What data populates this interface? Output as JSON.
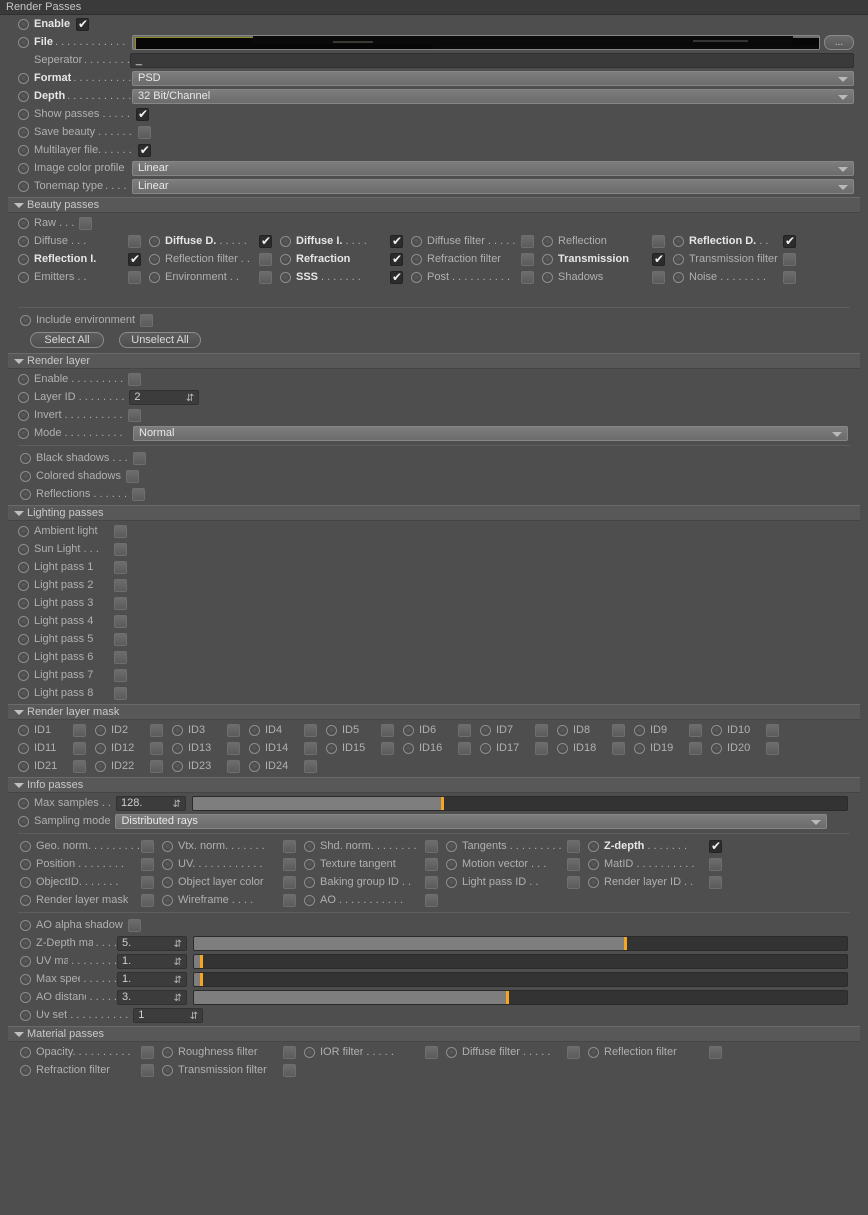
{
  "window": {
    "title": "Render Passes"
  },
  "top": {
    "enable": {
      "label": "Enable",
      "checked": true
    },
    "file": {
      "label": "File",
      "dots": ". . . . . . . . . . . .",
      "value": "",
      "browse_label": "..."
    },
    "seperator": {
      "label": "Seperator",
      "dots": ". . . . . . . .",
      "value": "_"
    },
    "format": {
      "label": "Format",
      "dots": ". . . . . . . . . .",
      "value": "PSD"
    },
    "depth": {
      "label": "Depth",
      "dots": ". . . . . . . . . . .",
      "value": "32 Bit/Channel"
    },
    "show_passes": {
      "label": "Show passes",
      "dots": ". . . . .",
      "checked": true
    },
    "save_beauty": {
      "label": "Save beauty",
      "dots": ". . . . . .",
      "checked": false
    },
    "multilayer_file": {
      "label": "Multilayer file.",
      "dots": ". . . . .",
      "checked": true
    },
    "image_color_profile": {
      "label": "Image color profile",
      "value": "Linear"
    },
    "tonemap_type": {
      "label": "Tonemap type",
      "dots": ". . . .",
      "value": "Linear"
    }
  },
  "beauty_passes": {
    "title": "Beauty passes",
    "raw": {
      "label": "Raw",
      "dots": ". . .",
      "checked": false,
      "bold": false
    },
    "rows": [
      [
        {
          "label": "Diffuse",
          "dots": ". . .",
          "checked": false,
          "bold": false
        },
        {
          "label": "Diffuse D.",
          "dots": ". . . . .",
          "checked": true,
          "bold": true
        },
        {
          "label": "Diffuse I.",
          "dots": ". . . .",
          "checked": true,
          "bold": true
        },
        {
          "label": "Diffuse filter",
          "dots": ". . . . .",
          "checked": false,
          "bold": false
        }
      ],
      [
        {
          "label": "Reflection",
          "dots": "",
          "checked": false,
          "bold": false
        },
        {
          "label": "Reflection D.",
          "dots": ". .",
          "checked": true,
          "bold": true
        },
        {
          "label": "Reflection I.",
          "dots": "",
          "checked": true,
          "bold": true
        },
        {
          "label": "Reflection filter",
          "dots": ". .",
          "checked": false,
          "bold": false
        }
      ],
      [
        {
          "label": "Refraction",
          "dots": "",
          "checked": true,
          "bold": true
        },
        {
          "label": "Refraction filter",
          "dots": "",
          "checked": false,
          "bold": false
        },
        {
          "label": "Transmission",
          "dots": "",
          "checked": true,
          "bold": true
        },
        {
          "label": "Transmission filter",
          "dots": "",
          "checked": false,
          "bold": false
        }
      ],
      [
        {
          "label": "Emitters",
          "dots": ". .",
          "checked": false,
          "bold": false
        },
        {
          "label": "Environment",
          "dots": ". .",
          "checked": false,
          "bold": false
        },
        {
          "label": "SSS",
          "dots": ". . . . . . .",
          "checked": true,
          "bold": true
        },
        {
          "label": "Post",
          "dots": ". . . . . . . . . .",
          "checked": false,
          "bold": false
        }
      ],
      [
        {
          "label": "Shadows",
          "dots": "",
          "checked": false,
          "bold": false
        },
        {
          "label": "Noise",
          "dots": ". . . . . . . .",
          "checked": false,
          "bold": false
        }
      ]
    ],
    "include_environment": {
      "label": "Include environment",
      "checked": false
    },
    "select_all_label": "Select All",
    "unselect_all_label": "Unselect All"
  },
  "render_layer": {
    "title": "Render layer",
    "enable": {
      "label": "Enable",
      "dots": ". . . . . . . . .",
      "checked": false
    },
    "layer_id": {
      "label": "Layer ID",
      "dots": ". . . . . . . .",
      "value": "2"
    },
    "invert": {
      "label": "Invert",
      "dots": ". . . . . . . . . .",
      "checked": false
    },
    "mode": {
      "label": "Mode",
      "dots": ". . . . . . . . . .",
      "value": "Normal"
    },
    "black_shadows": {
      "label": "Black shadows",
      "dots": ". . .",
      "checked": false
    },
    "colored_shadows": {
      "label": "Colored shadows",
      "dots": "",
      "checked": false
    },
    "reflections": {
      "label": "Reflections",
      "dots": ". . . . . .",
      "checked": false
    }
  },
  "lighting_passes": {
    "title": "Lighting passes",
    "items": [
      {
        "label": "Ambient light",
        "dots": "",
        "checked": false
      },
      {
        "label": "Sun Light",
        "dots": ". . .",
        "checked": false
      },
      {
        "label": "Light pass 1",
        "dots": "",
        "checked": false
      },
      {
        "label": "Light pass 2",
        "dots": "",
        "checked": false
      },
      {
        "label": "Light pass 3",
        "dots": "",
        "checked": false
      },
      {
        "label": "Light pass 4",
        "dots": "",
        "checked": false
      },
      {
        "label": "Light pass 5",
        "dots": "",
        "checked": false
      },
      {
        "label": "Light pass 6",
        "dots": "",
        "checked": false
      },
      {
        "label": "Light pass 7",
        "dots": "",
        "checked": false
      },
      {
        "label": "Light pass 8",
        "dots": "",
        "checked": false
      }
    ]
  },
  "render_layer_mask": {
    "title": "Render layer mask",
    "ids": [
      "ID1",
      "ID2",
      "ID3",
      "ID4",
      "ID5",
      "ID6",
      "ID7",
      "ID8",
      "ID9",
      "ID10",
      "ID11",
      "ID12",
      "ID13",
      "ID14",
      "ID15",
      "ID16",
      "ID17",
      "ID18",
      "ID19",
      "ID20",
      "ID21",
      "ID22",
      "ID23",
      "ID24"
    ]
  },
  "info_passes": {
    "title": "Info passes",
    "max_samples": {
      "label": "Max samples",
      "dots": ". .",
      "value": "128.",
      "fill_pct": 38,
      "mark_pct": 38
    },
    "sampling_mode": {
      "label": "Sampling mode",
      "value": "Distributed rays"
    },
    "rows": [
      [
        {
          "label": "Geo. norm.",
          "dots": ". . . . . . . .",
          "checked": false,
          "bold": false
        },
        {
          "label": "Vtx. norm.",
          "dots": ". . . . . .",
          "checked": false,
          "bold": false
        },
        {
          "label": "Shd. norm.",
          "dots": ". . . . . . .",
          "checked": false,
          "bold": false
        }
      ],
      [
        {
          "label": "Tangents",
          "dots": ". . . . . . . . .",
          "checked": false,
          "bold": false
        },
        {
          "label": "Z-depth",
          "dots": ". . . . . . .",
          "checked": true,
          "bold": true
        },
        {
          "label": "Position",
          "dots": ". . . . . . . .",
          "checked": false,
          "bold": false
        }
      ],
      [
        {
          "label": "UV.",
          "dots": ". . . . . . . . . . .",
          "checked": false,
          "bold": false
        },
        {
          "label": "Texture tangent",
          "dots": "",
          "checked": false,
          "bold": false
        },
        {
          "label": "Motion vector",
          "dots": ". . .",
          "checked": false,
          "bold": false
        }
      ],
      [
        {
          "label": "MatID",
          "dots": ". . . . . . . . . .",
          "checked": false,
          "bold": false
        },
        {
          "label": "ObjectID.",
          "dots": ". . . . . .",
          "checked": false,
          "bold": false
        },
        {
          "label": "Object layer color",
          "dots": "",
          "checked": false,
          "bold": false
        }
      ],
      [
        {
          "label": "Baking group ID",
          "dots": ". .",
          "checked": false,
          "bold": false
        },
        {
          "label": "Light pass ID",
          "dots": ". .",
          "checked": false,
          "bold": false
        },
        {
          "label": "Render layer ID",
          "dots": ". .",
          "checked": false,
          "bold": false
        }
      ],
      [
        {
          "label": "Render layer mask",
          "dots": "",
          "checked": false,
          "bold": false
        },
        {
          "label": "Wireframe",
          "dots": ". . . .",
          "checked": false,
          "bold": false
        },
        {
          "label": "AO",
          "dots": ". . . . . . . . . . .",
          "checked": false,
          "bold": false
        }
      ]
    ],
    "ao_alpha_shadow": {
      "label": "AO alpha shadow",
      "checked": false
    },
    "sliders": [
      {
        "label": "Z-Depth max",
        "dots": ". . . .",
        "value": "5.",
        "fill_pct": 66,
        "mark_pct": 66
      },
      {
        "label": "UV max",
        "dots": ". . . . . . . .",
        "value": "1.",
        "fill_pct": 1,
        "mark_pct": 1
      },
      {
        "label": "Max speed",
        "dots": ". . . . . .",
        "value": "1.",
        "fill_pct": 1,
        "mark_pct": 1
      },
      {
        "label": "AO distance",
        "dots": ". . . . .",
        "value": "3.",
        "fill_pct": 48,
        "mark_pct": 48
      }
    ],
    "uv_set": {
      "label": "Uv set",
      "dots": ". . . . . . . . . .",
      "value": "1"
    }
  },
  "material_passes": {
    "title": "Material passes",
    "rows": [
      [
        {
          "label": "Opacity.",
          "dots": ". . . . . . . . .",
          "checked": false
        },
        {
          "label": "Roughness filter",
          "dots": "",
          "checked": false
        },
        {
          "label": "IOR filter",
          "dots": ". . . . .",
          "checked": false
        }
      ],
      [
        {
          "label": "Diffuse filter",
          "dots": ". . . . .",
          "checked": false
        },
        {
          "label": "Reflection filter",
          "dots": "",
          "checked": false
        },
        {
          "label": "Refraction filter",
          "dots": "",
          "checked": false
        }
      ],
      [
        {
          "label": "Transmission filter",
          "dots": "",
          "checked": false
        }
      ]
    ]
  },
  "colors": {
    "accent": "#f5a520",
    "panel_bg": "#4e4e4e",
    "header_bg": "#585858",
    "redaction": "#070707"
  }
}
